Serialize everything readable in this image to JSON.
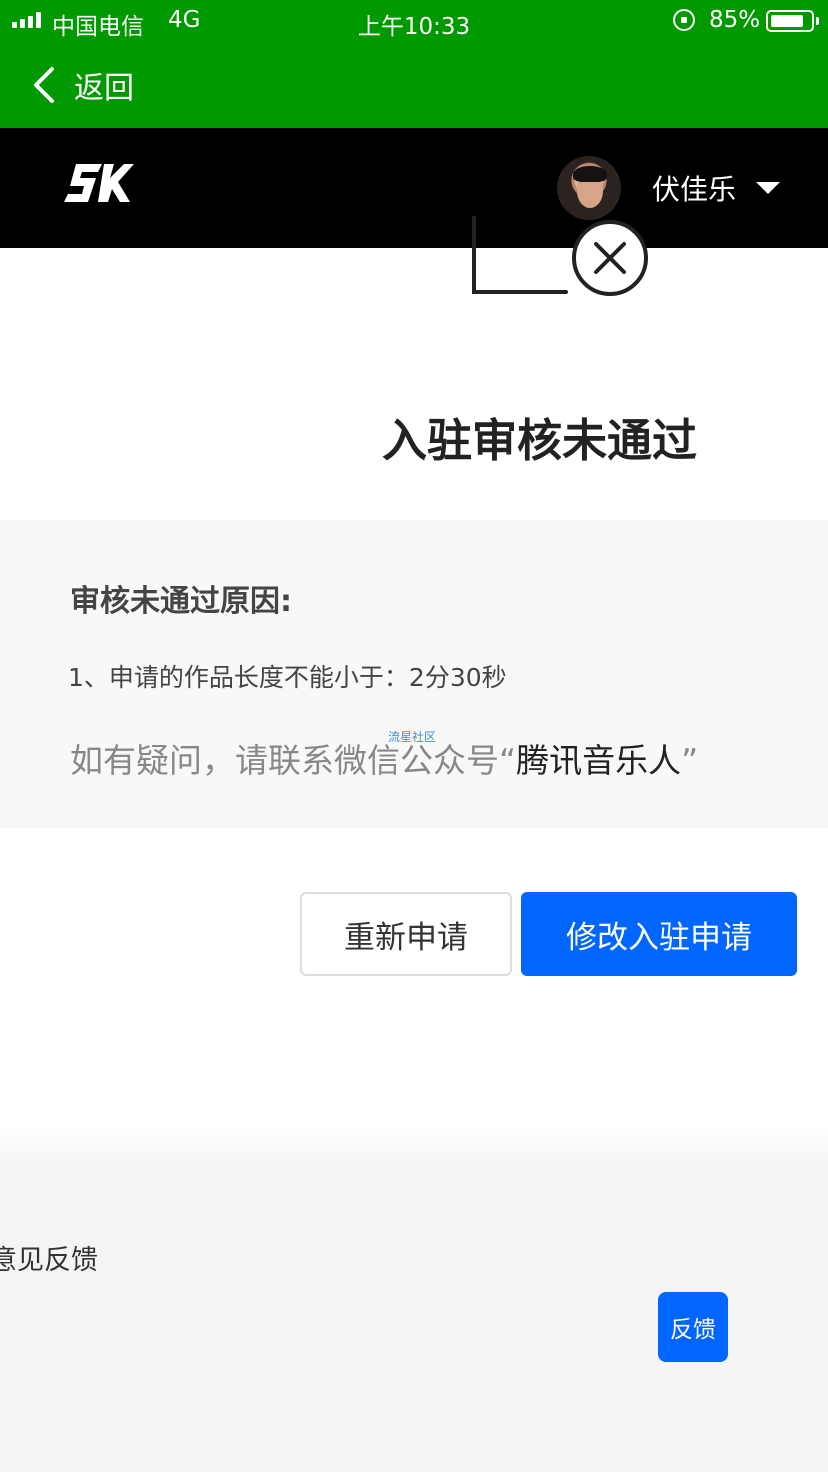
{
  "status_bar": {
    "carrier": "中国电信",
    "network": "4G",
    "time": "上午10:33",
    "battery_percent": "85%",
    "battery_level": 0.85
  },
  "nav": {
    "back_label": "返回"
  },
  "header": {
    "username": "伏佳乐",
    "brand_color": "#009a00"
  },
  "result": {
    "title": "入驻审核未通过"
  },
  "reason": {
    "heading": "审核未通过原因:",
    "items": [
      "1、申请的作品长度不能小于：2分30秒"
    ],
    "contact_prefix": "如有疑问，请联系微信公众号“",
    "contact_account": "腾讯音乐人",
    "contact_suffix": "”",
    "watermark": "流星社区"
  },
  "actions": {
    "reapply_label": "重新申请",
    "modify_label": "修改入驻申请",
    "accent_color": "#0066ff"
  },
  "footer": {
    "label": "意见反馈",
    "feedback_button_label": "反馈"
  }
}
